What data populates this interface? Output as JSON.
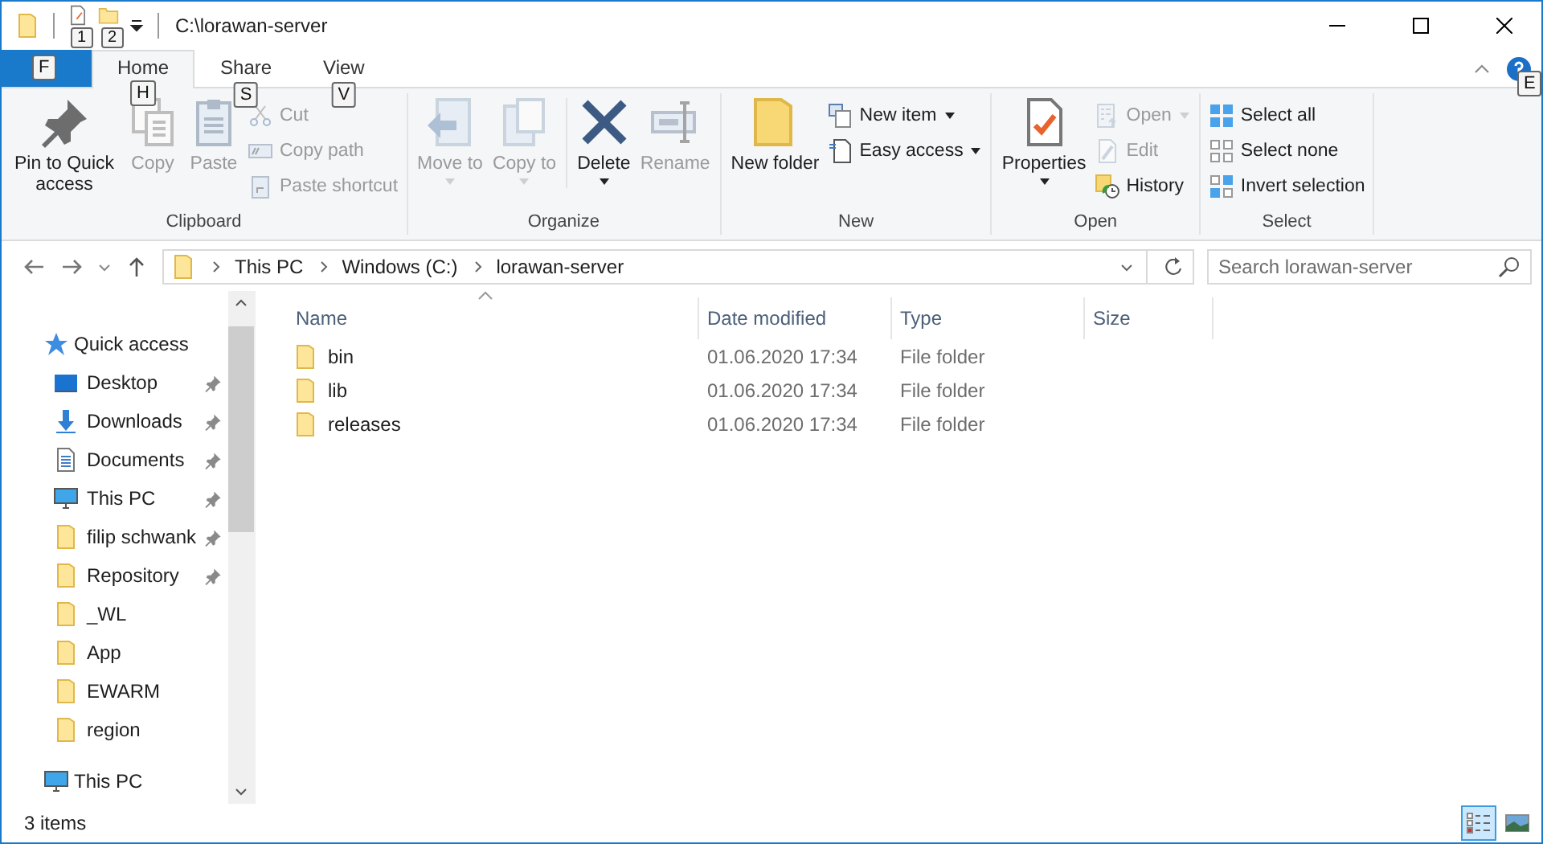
{
  "window": {
    "title": "C:\\lorawan-server",
    "quick_keytips": [
      "1",
      "2"
    ]
  },
  "file_tab": {
    "keytip": "F"
  },
  "tabs": [
    {
      "label": "Home",
      "keytip": "H",
      "selected": true
    },
    {
      "label": "Share",
      "keytip": "S",
      "selected": false
    },
    {
      "label": "View",
      "keytip": "V",
      "selected": false
    }
  ],
  "help_keytip": "E",
  "ribbon_groups": [
    {
      "label": "Clipboard",
      "items": [
        {
          "kind": "large",
          "label": "Pin to Quick access",
          "disabled": false
        },
        {
          "kind": "large",
          "label": "Copy",
          "disabled": true
        },
        {
          "kind": "large",
          "label": "Paste",
          "disabled": true
        },
        {
          "kind": "stack",
          "items": [
            {
              "label": "Cut",
              "disabled": true
            },
            {
              "label": "Copy path",
              "disabled": true
            },
            {
              "label": "Paste shortcut",
              "disabled": true
            }
          ]
        }
      ]
    },
    {
      "label": "Organize",
      "items": [
        {
          "kind": "large",
          "label": "Move to",
          "disabled": true,
          "dropdown": true
        },
        {
          "kind": "large",
          "label": "Copy to",
          "disabled": true,
          "dropdown": true
        },
        {
          "kind": "separator"
        },
        {
          "kind": "large",
          "label": "Delete",
          "disabled": false,
          "dropdown": true
        },
        {
          "kind": "large",
          "label": "Rename",
          "disabled": true
        }
      ]
    },
    {
      "label": "New",
      "items": [
        {
          "kind": "large",
          "label": "New folder",
          "disabled": false
        },
        {
          "kind": "stack",
          "items": [
            {
              "label": "New item",
              "disabled": false,
              "dropdown": true
            },
            {
              "label": "Easy access",
              "disabled": false,
              "dropdown": true
            }
          ]
        }
      ]
    },
    {
      "label": "Open",
      "items": [
        {
          "kind": "large",
          "label": "Properties",
          "disabled": false,
          "dropdown": true
        },
        {
          "kind": "stack",
          "items": [
            {
              "label": "Open",
              "disabled": true,
              "dropdown": true
            },
            {
              "label": "Edit",
              "disabled": true
            },
            {
              "label": "History",
              "disabled": false
            }
          ]
        }
      ]
    },
    {
      "label": "Select",
      "items": [
        {
          "kind": "stack",
          "items": [
            {
              "label": "Select all",
              "disabled": false
            },
            {
              "label": "Select none",
              "disabled": false
            },
            {
              "label": "Invert selection",
              "disabled": false
            }
          ]
        }
      ]
    }
  ],
  "address": {
    "crumbs": [
      "This PC",
      "Windows (C:)",
      "lorawan-server"
    ],
    "search_placeholder": "Search lorawan-server"
  },
  "nav": [
    {
      "label": "Quick access",
      "children": [
        {
          "label": "Desktop",
          "pinned": true
        },
        {
          "label": "Downloads",
          "pinned": true
        },
        {
          "label": "Documents",
          "pinned": true
        },
        {
          "label": "This PC",
          "pinned": true
        },
        {
          "label": "filip schwank",
          "pinned": true
        },
        {
          "label": "Repository",
          "pinned": true
        },
        {
          "label": "_WL",
          "pinned": false
        },
        {
          "label": "App",
          "pinned": false
        },
        {
          "label": "EWARM",
          "pinned": false
        },
        {
          "label": "region",
          "pinned": false
        }
      ]
    },
    {
      "label": "This PC"
    }
  ],
  "table": {
    "columns": [
      "Name",
      "Date modified",
      "Type",
      "Size"
    ],
    "rows": [
      {
        "name": "bin",
        "date": "01.06.2020 17:34",
        "type": "File folder"
      },
      {
        "name": "lib",
        "date": "01.06.2020 17:34",
        "type": "File folder"
      },
      {
        "name": "releases",
        "date": "01.06.2020 17:34",
        "type": "File folder"
      }
    ]
  },
  "status_bar": {
    "count": "3 items",
    "views": [
      {
        "kind": "details",
        "selected": true
      },
      {
        "kind": "large-icons",
        "selected": false
      }
    ]
  }
}
